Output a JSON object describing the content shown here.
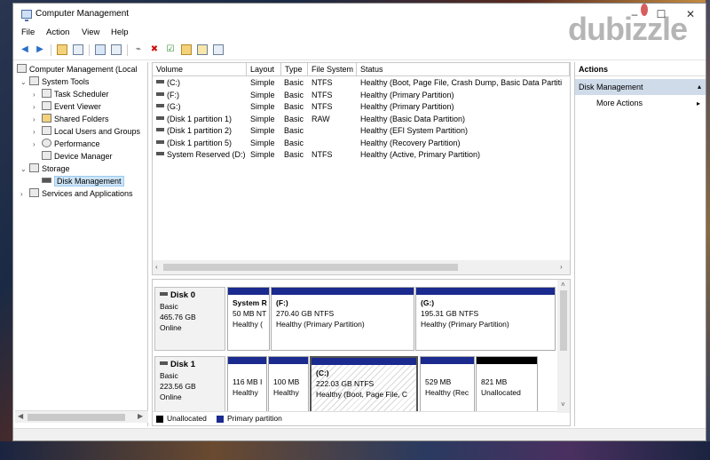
{
  "window": {
    "title": "Computer Management",
    "minimize": "–",
    "maximize": "☐",
    "close": "✕"
  },
  "watermark": {
    "text": "dubizzle"
  },
  "menu": [
    "File",
    "Action",
    "View",
    "Help"
  ],
  "tree": {
    "root": "Computer Management (Local",
    "system_tools": "System Tools",
    "task_scheduler": "Task Scheduler",
    "event_viewer": "Event Viewer",
    "shared_folders": "Shared Folders",
    "local_users": "Local Users and Groups",
    "performance": "Performance",
    "device_manager": "Device Manager",
    "storage": "Storage",
    "disk_management": "Disk Management",
    "services": "Services and Applications"
  },
  "volumes": {
    "headers": [
      "Volume",
      "Layout",
      "Type",
      "File System",
      "Status"
    ],
    "rows": [
      [
        "(C:)",
        "Simple",
        "Basic",
        "NTFS",
        "Healthy (Boot, Page File, Crash Dump, Basic Data Partiti"
      ],
      [
        "(F:)",
        "Simple",
        "Basic",
        "NTFS",
        "Healthy (Primary Partition)"
      ],
      [
        "(G:)",
        "Simple",
        "Basic",
        "NTFS",
        "Healthy (Primary Partition)"
      ],
      [
        "(Disk 1 partition 1)",
        "Simple",
        "Basic",
        "RAW",
        "Healthy (Basic Data Partition)"
      ],
      [
        "(Disk 1 partition 2)",
        "Simple",
        "Basic",
        "",
        "Healthy (EFI System Partition)"
      ],
      [
        "(Disk 1 partition 5)",
        "Simple",
        "Basic",
        "",
        "Healthy (Recovery Partition)"
      ],
      [
        "System Reserved (D:)",
        "Simple",
        "Basic",
        "NTFS",
        "Healthy (Active, Primary Partition)"
      ]
    ]
  },
  "disks": {
    "disk0": {
      "name": "Disk 0",
      "type": "Basic",
      "size": "465.76 GB",
      "status": "Online",
      "p1_label": "System R",
      "p1_size": "50 MB NT",
      "p1_status": "Healthy (",
      "p2_label": "(F:)",
      "p2_size": "270.40 GB NTFS",
      "p2_status": "Healthy (Primary Partition)",
      "p3_label": "(G:)",
      "p3_size": "195.31 GB NTFS",
      "p3_status": "Healthy (Primary Partition)"
    },
    "disk1": {
      "name": "Disk 1",
      "type": "Basic",
      "size": "223.56 GB",
      "status": "Online",
      "p1_size": "116 MB I",
      "p1_status": "Healthy",
      "p2_size": "100 MB",
      "p2_status": "Healthy",
      "p3_label": "(C:)",
      "p3_size": "222.03 GB NTFS",
      "p3_status": "Healthy (Boot, Page File, C",
      "p4_size": "529 MB",
      "p4_status": "Healthy (Rec",
      "p5_size": "821 MB",
      "p5_status": "Unallocated"
    }
  },
  "legend": {
    "unallocated": "Unallocated",
    "primary": "Primary partition"
  },
  "actions": {
    "title": "Actions",
    "selected": "Disk Management",
    "more": "More Actions"
  },
  "colors": {
    "primary_partition": "#1a2a8e",
    "unallocated": "#000000",
    "selection": "#cce4f7"
  }
}
